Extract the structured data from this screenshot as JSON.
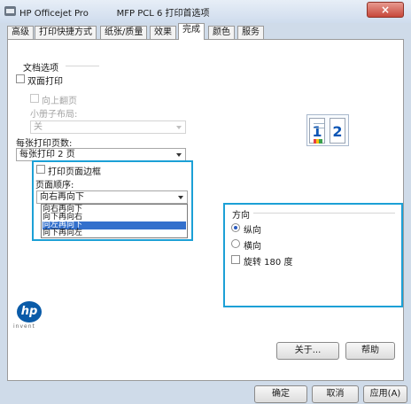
{
  "window": {
    "title": "HP Officejet Pro          MFP PCL 6 打印首选项",
    "close_label": "×"
  },
  "tabs": [
    {
      "label": "高级"
    },
    {
      "label": "打印快捷方式"
    },
    {
      "label": "纸张/质量"
    },
    {
      "label": "效果"
    },
    {
      "label": "完成"
    },
    {
      "label": "颜色"
    },
    {
      "label": "服务"
    }
  ],
  "document_options": {
    "title": "文档选项",
    "duplex_label": "双面打印",
    "flip_pages_label": "向上翻页",
    "booklet_layout_label": "小册子布局:",
    "booklet_value": "关"
  },
  "pages_per_sheet": {
    "label": "每张打印页数:",
    "value": "每张打印 2 页"
  },
  "print_border": {
    "label": "打印页面边框"
  },
  "page_order": {
    "label": "页面顺序:",
    "value": "向右再向下",
    "options": [
      "向右再向下",
      "向下再向右",
      "向左再向下",
      "向下再向左"
    ],
    "selected_index": 2
  },
  "orientation": {
    "title": "方向",
    "portrait_label": "纵向",
    "landscape_label": "横向",
    "rotate_label": "旋转 180 度"
  },
  "preview": {
    "page1": "1",
    "page2": "2"
  },
  "brand": {
    "logo_text": "hp",
    "tagline": "invent"
  },
  "buttons": {
    "about": "关于...",
    "help": "帮助",
    "ok": "确定",
    "cancel": "取消",
    "apply": "应用(A)"
  }
}
